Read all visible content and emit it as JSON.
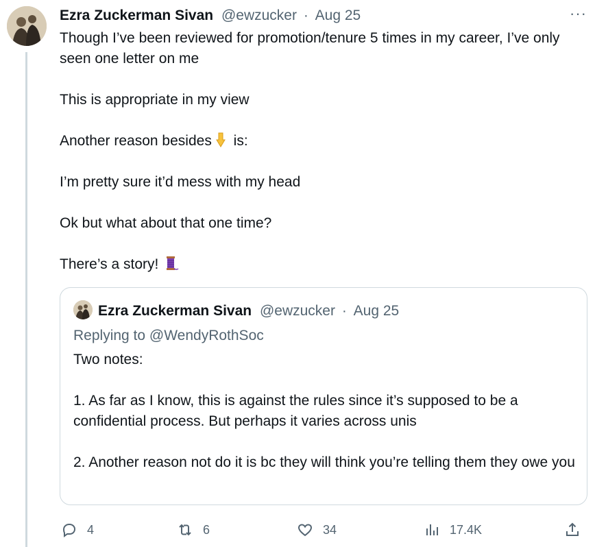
{
  "tweet": {
    "author_name": "Ezra Zuckerman Sivan",
    "handle": "@ewzucker",
    "separator": "·",
    "date": "Aug 25",
    "more_label": "···",
    "lines": [
      "Though I’ve been reviewed for promotion/tenure 5 times in my career, I’ve only seen one letter on me",
      "This is appropriate in my view",
      "Another reason besides",
      " is:",
      "I’m pretty sure it’d mess with my head",
      "Ok but what about that one time?",
      "There’s a story! "
    ],
    "emojis": [
      "backhand-index-pointing-down",
      "thread-spool"
    ]
  },
  "quote": {
    "author_name": "Ezra Zuckerman Sivan",
    "handle": "@ewzucker",
    "separator": "·",
    "date": "Aug 25",
    "replying_prefix": "Replying to ",
    "replying_handle": "@WendyRothSoc",
    "lines": [
      "Two notes:",
      "1. As far as I know, this is against the rules since it’s supposed to be a confidential process. But perhaps it varies across unis",
      "2. Another reason not do it is bc they will think you’re telling them they owe you"
    ]
  },
  "actions": {
    "replies": "4",
    "retweets": "6",
    "likes": "34",
    "views": "17.4K"
  },
  "colors": {
    "text": "#0f1419",
    "secondary": "#536471",
    "border": "#cfd9de"
  }
}
